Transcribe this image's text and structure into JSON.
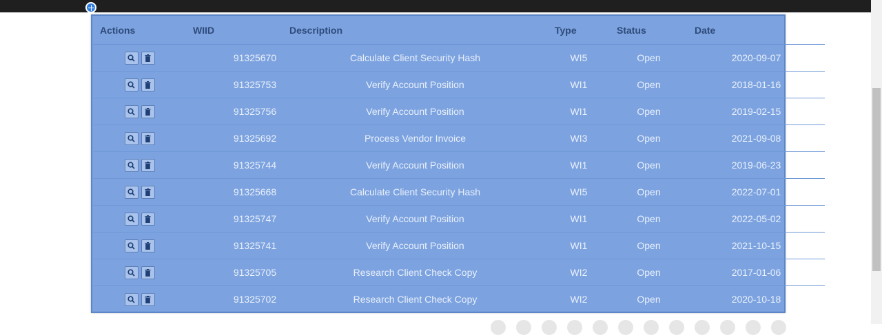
{
  "table": {
    "headers": {
      "actions": "Actions",
      "wiid": "WIID",
      "description": "Description",
      "type": "Type",
      "status": "Status",
      "date": "Date"
    },
    "rows": [
      {
        "wiid": "91325670",
        "description": "Calculate Client Security Hash",
        "type": "WI5",
        "status": "Open",
        "date": "2020-09-07"
      },
      {
        "wiid": "91325753",
        "description": "Verify Account Position",
        "type": "WI1",
        "status": "Open",
        "date": "2018-01-16"
      },
      {
        "wiid": "91325756",
        "description": "Verify Account Position",
        "type": "WI1",
        "status": "Open",
        "date": "2019-02-15"
      },
      {
        "wiid": "91325692",
        "description": "Process Vendor Invoice",
        "type": "WI3",
        "status": "Open",
        "date": "2021-09-08"
      },
      {
        "wiid": "91325744",
        "description": "Verify Account Position",
        "type": "WI1",
        "status": "Open",
        "date": "2019-06-23"
      },
      {
        "wiid": "91325668",
        "description": "Calculate Client Security Hash",
        "type": "WI5",
        "status": "Open",
        "date": "2022-07-01"
      },
      {
        "wiid": "91325747",
        "description": "Verify Account Position",
        "type": "WI1",
        "status": "Open",
        "date": "2022-05-02"
      },
      {
        "wiid": "91325741",
        "description": "Verify Account Position",
        "type": "WI1",
        "status": "Open",
        "date": "2021-10-15"
      },
      {
        "wiid": "91325705",
        "description": "Research Client Check Copy",
        "type": "WI2",
        "status": "Open",
        "date": "2017-01-06"
      },
      {
        "wiid": "91325702",
        "description": "Research Client Check Copy",
        "type": "WI2",
        "status": "Open",
        "date": "2020-10-18"
      }
    ]
  },
  "icons": {
    "view": "magnifier-icon",
    "delete": "trash-icon",
    "selection": "crosshair-icon"
  },
  "colors": {
    "table_background": "#7ca3e0",
    "header_text": "#2e4a7a",
    "cell_text": "#e9effa",
    "top_bar": "#1f1f1f"
  }
}
